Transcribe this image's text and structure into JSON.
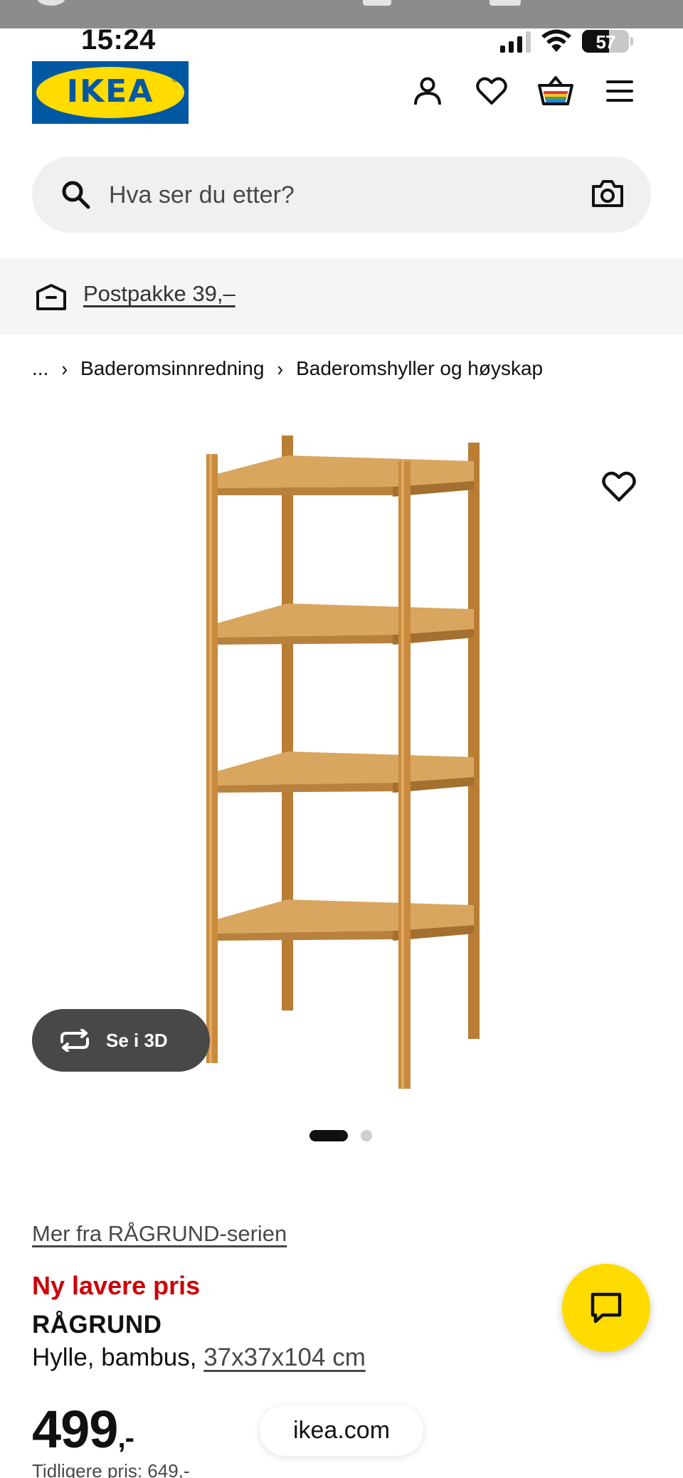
{
  "status_bar": {
    "time": "15:24",
    "battery": "57",
    "battery_level": 0.57
  },
  "header": {
    "logo_text": "IKEA",
    "icons": [
      "account-icon",
      "heart-icon",
      "cart-icon",
      "menu-icon"
    ]
  },
  "search": {
    "placeholder": "Hva ser du etter?"
  },
  "delivery": {
    "label": "Postpakke 39,–"
  },
  "breadcrumb": {
    "ellipsis": "...",
    "items": [
      "Baderomsinnredning",
      "Baderomshyller og høyskap"
    ]
  },
  "gallery": {
    "view_3d_label": "Se i 3D",
    "current_image": 1,
    "image_count": 2
  },
  "product": {
    "series_link": "Mer fra RÅGRUND-serien",
    "promo": "Ny lavere pris",
    "name": "RÅGRUND",
    "description": "Hylle, bambus, ",
    "dimensions": "37x37x104 cm",
    "price": "499",
    "price_suffix": ",-",
    "previous_price": "Tidligere pris: 649,-"
  },
  "browser": {
    "url": "ikea.com"
  },
  "colors": {
    "ikea_blue": "#0058a3",
    "ikea_yellow": "#ffdb00",
    "promo_red": "#cc0008",
    "bamboo": "#c98a3d"
  }
}
